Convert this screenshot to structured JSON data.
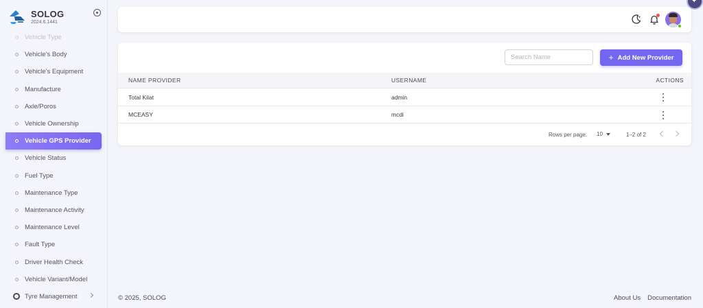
{
  "brand": {
    "name": "SOLOG",
    "version": "2024.6.1441",
    "logo_icon": "solog-logo",
    "accent": "#2b7fd0"
  },
  "sidebar": {
    "items": [
      {
        "label": "Vehicle Type",
        "state": "faded"
      },
      {
        "label": "Vehicle's Body"
      },
      {
        "label": "Vehicle's Equipment"
      },
      {
        "label": "Manufacture"
      },
      {
        "label": "Axle/Poros"
      },
      {
        "label": "Vehicle Ownership"
      },
      {
        "label": "Vehicle GPS Provider",
        "state": "active"
      },
      {
        "label": "Vehicle Status"
      },
      {
        "label": "Fuel Type"
      },
      {
        "label": "Maintenance Type"
      },
      {
        "label": "Maintenance Activity"
      },
      {
        "label": "Maintenance Level"
      },
      {
        "label": "Fault Type"
      },
      {
        "label": "Driver Health Check"
      },
      {
        "label": "Vehicle Variant/Model"
      },
      {
        "label": "Tyre Management",
        "state": "group"
      }
    ]
  },
  "topbar": {
    "theme_icon": "moon-icon",
    "notification_icon": "bell-icon",
    "avatar": "user-avatar"
  },
  "toolbar": {
    "search_placeholder": "Search Name",
    "add_label": "Add New Provider",
    "add_icon": "plus-icon"
  },
  "table": {
    "columns": [
      "NAME PROVIDER",
      "USERNAME",
      "ACTIONS"
    ],
    "rows": [
      {
        "name": "Total Kilat",
        "username": "admin"
      },
      {
        "name": "MCEASY",
        "username": "mcdi"
      }
    ]
  },
  "pagination": {
    "rows_per_page_label": "Rows per page:",
    "rows_per_page": "10",
    "range": "1–2 of 2"
  },
  "footer": {
    "copyright": "© 2025, SOLOG",
    "links": [
      "About Us",
      "Documentation"
    ]
  },
  "colors": {
    "primary": "#7367f0",
    "background": "#f4f5fa",
    "notification": "#ff4c51",
    "online": "#56ca00"
  }
}
